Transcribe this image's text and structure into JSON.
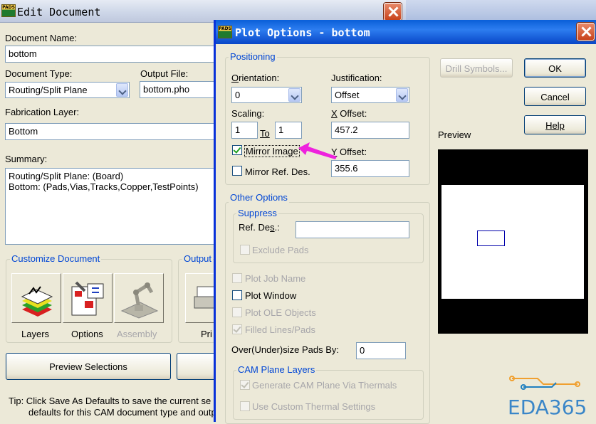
{
  "edit_document": {
    "title": "Edit Document",
    "document_name_label": "Document Name:",
    "document_name_value": "bottom",
    "document_type_label": "Document Type:",
    "document_type_value": "Routing/Split Plane",
    "output_file_label": "Output File:",
    "output_file_value": "bottom.pho",
    "fabrication_layer_label": "Fabrication Layer:",
    "fabrication_layer_value": "Bottom",
    "summary_label": "Summary:",
    "summary_line1": "Routing/Split Plane: (Board)",
    "summary_line2": "Bottom: (Pads,Vias,Tracks,Copper,TestPoints)",
    "customize_group": "Customize Document",
    "output_group": "Output",
    "layers_label": "Layers",
    "options_label": "Options",
    "assembly_label": "Assembly",
    "print_label": "Pri",
    "preview_selections": "Preview Selections",
    "tip_line1": "Tip:  Click Save As Defaults to save the current se",
    "tip_line2": "defaults for this CAM document type and outp"
  },
  "plot_options": {
    "title": "Plot Options - bottom",
    "positioning_group": "Positioning",
    "orientation_label": "Orientation:",
    "orientation_value": "0",
    "justification_label": "Justification:",
    "justification_value": "Offset",
    "scaling_label": "Scaling:",
    "scaling_value": "1",
    "to_label": "To",
    "to_value": "1",
    "x_offset_label": "X Offset:",
    "x_offset_value": "457.2",
    "y_offset_label": "Y Offset:",
    "y_offset_value": "355.6",
    "mirror_image_label": "Mirror Image",
    "mirror_image_checked": true,
    "mirror_ref_des_label": "Mirror Ref. Des.",
    "mirror_ref_des_checked": false,
    "drill_symbols": "Drill Symbols...",
    "ok": "OK",
    "cancel": "Cancel",
    "help": "Help",
    "preview_label": "Preview",
    "other_options_group": "Other Options",
    "suppress_group": "Suppress",
    "ref_des_label": "Ref. Des.:",
    "ref_des_value": "",
    "exclude_pads_label": "Exclude Pads",
    "plot_job_name_label": "Plot Job Name",
    "plot_window_label": "Plot Window",
    "plot_ole_label": "Plot OLE Objects",
    "filled_lines_label": "Filled Lines/Pads",
    "oversize_label": "Over(Under)size Pads By:",
    "oversize_value": "0",
    "cam_plane_group": "CAM Plane Layers",
    "generate_thermals_label": "Generate CAM Plane Via Thermals",
    "custom_thermal_label": "Use Custom Thermal Settings"
  },
  "watermark": {
    "text": "EDA365"
  },
  "colors": {
    "group_title": "#0046d5",
    "annotation_arrow": "#ee22dd",
    "preview_bg": "#000000"
  }
}
